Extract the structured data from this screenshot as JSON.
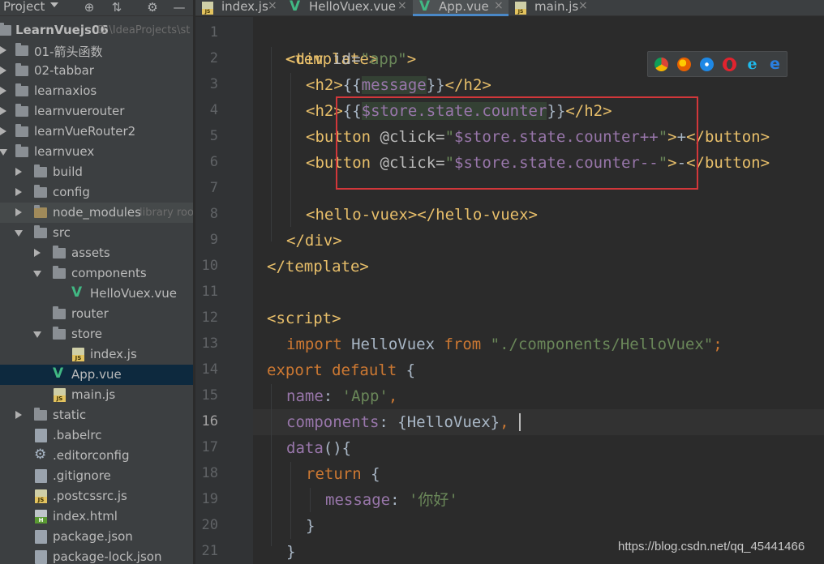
{
  "project_panel": {
    "title": "Project",
    "toolbar_icons": [
      "crosshair-icon",
      "collapse-icon",
      "gear-icon",
      "minimize-icon"
    ],
    "tree": [
      {
        "label": "LearnVuejs06",
        "hint": "D:\\IdeaProjects\\st",
        "icon": "folder",
        "bold": true
      },
      {
        "label": "01-箭头函数",
        "icon": "folder"
      },
      {
        "label": "02-tabbar",
        "icon": "folder"
      },
      {
        "label": "learnaxios",
        "icon": "folder"
      },
      {
        "label": "learnvuerouter",
        "icon": "folder"
      },
      {
        "label": "learnVueRouter2",
        "icon": "folder"
      },
      {
        "label": "learnvuex",
        "icon": "folder"
      },
      {
        "label": "build",
        "icon": "folder"
      },
      {
        "label": "config",
        "icon": "folder"
      },
      {
        "label": "node_modules",
        "hint": "library roo",
        "icon": "folder"
      },
      {
        "label": "src",
        "icon": "folder"
      },
      {
        "label": "assets",
        "icon": "folder"
      },
      {
        "label": "components",
        "icon": "folder"
      },
      {
        "label": "HelloVuex.vue",
        "icon": "vue"
      },
      {
        "label": "router",
        "icon": "folder"
      },
      {
        "label": "store",
        "icon": "folder"
      },
      {
        "label": "index.js",
        "icon": "js"
      },
      {
        "label": "App.vue",
        "icon": "vue",
        "selected": true
      },
      {
        "label": "main.js",
        "icon": "js"
      },
      {
        "label": "static",
        "icon": "folder"
      },
      {
        "label": ".babelrc",
        "icon": "config"
      },
      {
        "label": ".editorconfig",
        "icon": "gear"
      },
      {
        "label": ".gitignore",
        "icon": "config"
      },
      {
        "label": ".postcssrc.js",
        "icon": "js"
      },
      {
        "label": "index.html",
        "icon": "html"
      },
      {
        "label": "package.json",
        "icon": "config"
      },
      {
        "label": "package-lock.json",
        "icon": "config"
      }
    ]
  },
  "tabs": [
    {
      "label": "index.js",
      "icon": "js-file-icon"
    },
    {
      "label": "HelloVuex.vue",
      "icon": "vue-file-icon"
    },
    {
      "label": "App.vue",
      "icon": "vue-file-icon",
      "active": true
    },
    {
      "label": "main.js",
      "icon": "js-file-icon"
    }
  ],
  "editor": {
    "current_line": "16",
    "line_numbers": [
      "1",
      "2",
      "3",
      "4",
      "5",
      "6",
      "7",
      "8",
      "9",
      "10",
      "11",
      "12",
      "13",
      "14",
      "15",
      "16",
      "17",
      "18",
      "19",
      "20",
      "21"
    ],
    "code": {
      "l1": {
        "a": "<template>"
      },
      "l2": {
        "a": "<div ",
        "b": "id=",
        "c": "\"app\"",
        "d": ">"
      },
      "l3": {
        "a": "<h2>",
        "b": "{{",
        "c": "message",
        "d": "}}",
        "e": "</h2>"
      },
      "l4": {
        "a": "<h2>",
        "b": "{{",
        "c": "$store.state.counter",
        "d": "}}",
        "e": "</h2>"
      },
      "l5": {
        "a": "<button ",
        "b": "@click=",
        "c": "\"",
        "d": "$store.state.counter++",
        "e": "\"",
        "f": ">",
        "g": "+",
        "h": "</button>"
      },
      "l6": {
        "a": "<button ",
        "b": "@click=",
        "c": "\"",
        "d": "$store.state.counter--",
        "e": "\"",
        "f": ">",
        "g": "-",
        "h": "</button>"
      },
      "l8": {
        "a": "<hello-vuex></hello-vuex>"
      },
      "l9": {
        "a": "</div>"
      },
      "l10": {
        "a": "</template>"
      },
      "l12": {
        "a": "<script>"
      },
      "l13": {
        "a": "import ",
        "b": "HelloVuex ",
        "c": "from ",
        "d": "\"./components/HelloVuex\"",
        "e": ";"
      },
      "l14": {
        "a": "export default ",
        "b": "{"
      },
      "l15": {
        "a": "name",
        "b": ": ",
        "c": "'App'",
        "d": ","
      },
      "l16": {
        "a": "components",
        "b": ": {HelloVuex}",
        "c": ","
      },
      "l17": {
        "a": "data",
        "b": "(){"
      },
      "l18": {
        "a": "return ",
        "b": "{"
      },
      "l19": {
        "a": "message",
        "b": ": ",
        "c": "'你好'"
      },
      "l20": {
        "a": "}"
      },
      "l21": {
        "a": "}"
      }
    }
  },
  "browser_icons": [
    "chrome-icon",
    "firefox-icon",
    "safari-icon",
    "opera-icon",
    "ie-icon",
    "edge-icon"
  ],
  "watermark": "https://blog.csdn.net/qq_45441466",
  "colors": {
    "highlight_box": "#d2373a",
    "vue_green": "#41b883",
    "tag": "#e8bf6a",
    "string": "#6a8759",
    "keyword": "#cc7832",
    "property": "#9876aa"
  }
}
